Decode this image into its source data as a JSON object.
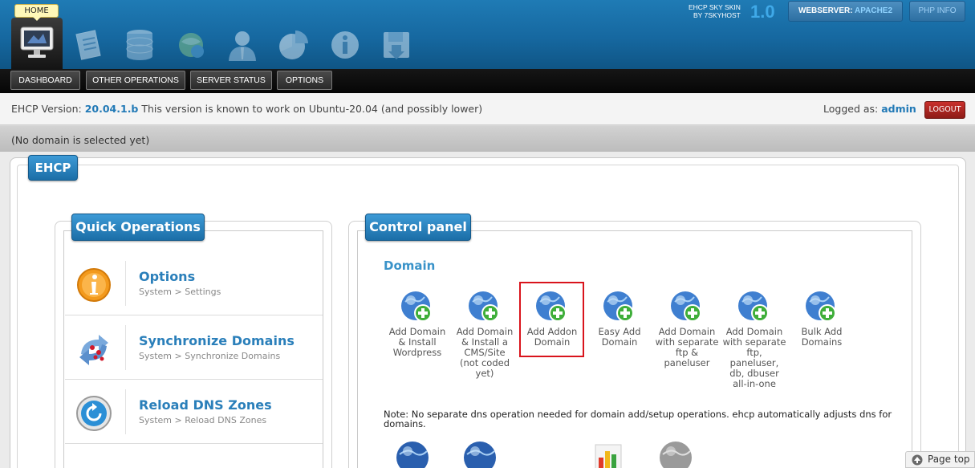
{
  "header": {
    "home_tooltip": "HOME",
    "skin_line1": "EHCP SKY SKIN",
    "skin_line2": "BY 7SKYHOST",
    "skin_version": "1.0",
    "webserver_label": "WEBSERVER:",
    "webserver_value": "APACHE2",
    "phpinfo_label": "PHP INFO",
    "icons": [
      "monitor-icon",
      "document-icon",
      "database-icon",
      "ftp-icon",
      "user-icon",
      "pie-chart-icon",
      "info-icon",
      "save-icon"
    ]
  },
  "nav": {
    "items": [
      {
        "label": "DASHBOARD"
      },
      {
        "label": "OTHER OPERATIONS"
      },
      {
        "label": "SERVER STATUS"
      },
      {
        "label": "OPTIONS"
      }
    ]
  },
  "info": {
    "version_prefix": "EHCP Version:",
    "version": "20.04.1.b",
    "version_note": "This version is known to work on Ubuntu-20.04 (and possibly lower)",
    "logged_prefix": "Logged as:",
    "user": "admin",
    "logout_label": "LOGOUT",
    "domain_status": "(No domain is selected yet)"
  },
  "main": {
    "title": "EHCP",
    "quick_ops": {
      "title": "Quick Operations",
      "items": [
        {
          "title": "Options",
          "subtitle": "System > Settings",
          "icon": "info-icon"
        },
        {
          "title": "Synchronize Domains",
          "subtitle": "System > Synchronize Domains",
          "icon": "sync-icon"
        },
        {
          "title": "Reload DNS Zones",
          "subtitle": "System > Reload DNS Zones",
          "icon": "reload-icon"
        }
      ]
    },
    "control_panel": {
      "title": "Control panel",
      "section": "Domain",
      "items": [
        {
          "lines": [
            "Add Domain",
            "& Install",
            "Wordpress"
          ]
        },
        {
          "lines": [
            "Add Domain",
            "& Install a",
            "CMS/Site",
            "(not coded",
            "yet)"
          ]
        },
        {
          "lines": [
            "Add Addon",
            "Domain"
          ]
        },
        {
          "lines": [
            "Easy Add",
            "Domain"
          ]
        },
        {
          "lines": [
            "Add Domain",
            "with separate",
            "ftp &",
            "paneluser"
          ]
        },
        {
          "lines": [
            "Add Domain",
            "with separate",
            "ftp,",
            "paneluser,",
            "db, dbuser",
            "all-in-one"
          ]
        },
        {
          "lines": [
            "Bulk Add",
            "Domains"
          ]
        }
      ],
      "note": "Note: No separate dns operation needed for domain add/setup operations. ehcp automatically adjusts dns for domains."
    }
  },
  "footer": {
    "page_top_label": "Page top"
  },
  "colors": {
    "accent": "#2a7fba",
    "header_blue": "#1668a0",
    "logout_red": "#b0221e",
    "highlight_red": "#d9141c"
  }
}
